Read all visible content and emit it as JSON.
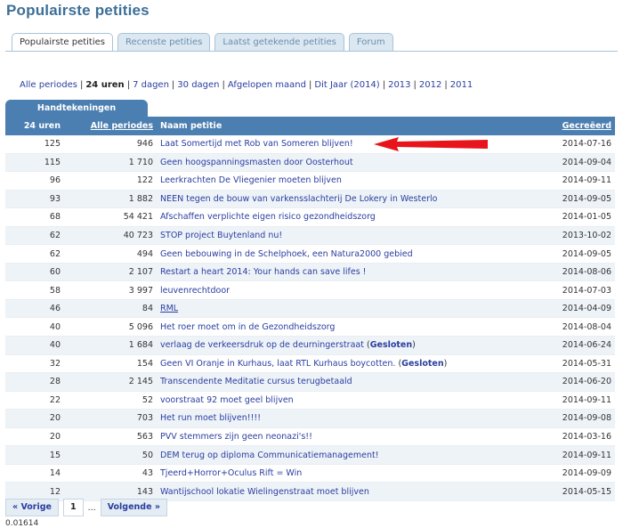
{
  "page": {
    "title": "Populairste petities"
  },
  "tabs": [
    {
      "label": "Populairste petities",
      "active": true
    },
    {
      "label": "Recenste petities",
      "active": false
    },
    {
      "label": "Laatst getekende petities",
      "active": false
    },
    {
      "label": "Forum",
      "active": false
    }
  ],
  "periods": {
    "all": "Alle periodes",
    "h24": "24 uren",
    "d7": "7 dagen",
    "d30": "30 dagen",
    "month": "Afgelopen maand",
    "year": "Dit Jaar (2014)",
    "y2013": "2013",
    "y2012": "2012",
    "y2011": "2011"
  },
  "table": {
    "group_header": "Handtekeningen",
    "col_24h": "24 uren",
    "col_all": "Alle periodes",
    "col_name": "Naam petitie",
    "col_created": "Gecreëerd",
    "closed_label": "Gesloten",
    "rows": [
      {
        "h24": "125",
        "all": "946",
        "name": "Laat Somertijd met Rob van Someren blijven!",
        "date": "2014-07-16"
      },
      {
        "h24": "115",
        "all": "1 710",
        "name": "Geen hoogspanningsmasten door Oosterhout",
        "date": "2014-09-04"
      },
      {
        "h24": "96",
        "all": "122",
        "name": "Leerkrachten De Vliegenier moeten blijven",
        "date": "2014-09-11"
      },
      {
        "h24": "93",
        "all": "1 882",
        "name": "NEEN tegen de bouw van varkensslachterij De Lokery in Westerlo",
        "date": "2014-09-05"
      },
      {
        "h24": "68",
        "all": "54 421",
        "name": "Afschaffen verplichte eigen risico gezondheidszorg",
        "date": "2014-01-05"
      },
      {
        "h24": "62",
        "all": "40 723",
        "name": "STOP project Buytenland nu!",
        "date": "2013-10-02"
      },
      {
        "h24": "62",
        "all": "494",
        "name": "Geen bebouwing in de Schelphoek, een Natura2000 gebied",
        "date": "2014-09-05"
      },
      {
        "h24": "60",
        "all": "2 107",
        "name": "Restart a heart 2014: Your hands can save lifes !",
        "date": "2014-08-06"
      },
      {
        "h24": "58",
        "all": "3 997",
        "name": "leuvenrechtdoor",
        "date": "2014-07-03"
      },
      {
        "h24": "46",
        "all": "84",
        "name": "RML",
        "date": "2014-04-09"
      },
      {
        "h24": "40",
        "all": "5 096",
        "name": "Het roer moet om in de Gezondheidszorg",
        "date": "2014-08-04"
      },
      {
        "h24": "40",
        "all": "1 684",
        "name": "verlaag de verkeersdruk op de deurningerstraat",
        "date": "2014-06-24"
      },
      {
        "h24": "32",
        "all": "154",
        "name": "Geen VI Oranje in Kurhaus, laat RTL Kurhaus boycotten.",
        "date": "2014-05-31"
      },
      {
        "h24": "28",
        "all": "2 145",
        "name": "Transcendente Meditatie cursus terugbetaald",
        "date": "2014-06-20"
      },
      {
        "h24": "22",
        "all": "52",
        "name": "voorstraat 92 moet geel blijven",
        "date": "2014-09-11"
      },
      {
        "h24": "20",
        "all": "703",
        "name": "Het run moet blijven!!!!",
        "date": "2014-09-08"
      },
      {
        "h24": "20",
        "all": "563",
        "name": "PVV stemmers zijn geen neonazi's!!",
        "date": "2014-03-16"
      },
      {
        "h24": "15",
        "all": "50",
        "name": "DEM terug op diploma Communicatiemanagement!",
        "date": "2014-09-11"
      },
      {
        "h24": "14",
        "all": "43",
        "name": "Tjeerd+Horror+Oculus Rift = Win",
        "date": "2014-09-09"
      },
      {
        "h24": "12",
        "all": "143",
        "name": "Wantijschool lokatie Wielingenstraat moet blijven",
        "date": "2014-05-15"
      }
    ]
  },
  "pager": {
    "prev": "« Vorige",
    "current": "1",
    "dots": "...",
    "next": "Volgende »"
  },
  "footer": {
    "timer": "0.01614"
  },
  "annotation": {
    "arrow_color": "#e8141b"
  }
}
